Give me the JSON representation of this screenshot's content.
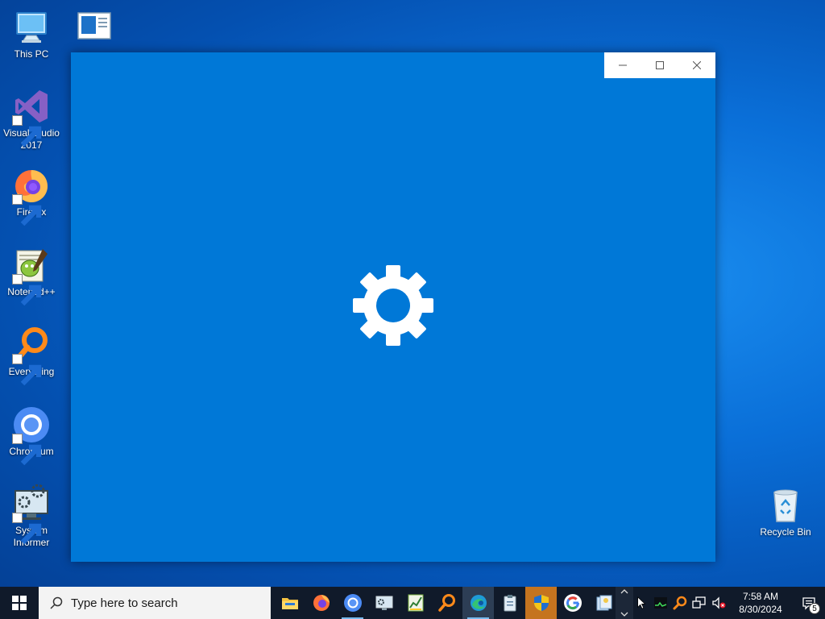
{
  "desktop": {
    "icons": [
      {
        "label": "This PC",
        "icon": "this-pc-icon"
      },
      {
        "label": "",
        "icon": "document-icon"
      },
      {
        "label": "Visual Studio 2017",
        "icon": "visual-studio-icon"
      },
      {
        "label": "Firefox",
        "icon": "firefox-icon"
      },
      {
        "label": "Notepad++",
        "icon": "notepad-plus-plus-icon"
      },
      {
        "label": "Everything",
        "icon": "everything-search-icon"
      },
      {
        "label": "Chromium",
        "icon": "chromium-icon"
      },
      {
        "label": "System Informer",
        "icon": "system-informer-icon"
      },
      {
        "label": "Recycle Bin",
        "icon": "recycle-bin-icon"
      }
    ]
  },
  "window": {
    "background": "#0078d7",
    "splash_icon": "gear-icon",
    "controls": [
      "minimize-icon",
      "maximize-icon",
      "close-icon"
    ]
  },
  "taskbar": {
    "search_placeholder": "Type here to search",
    "pinned": [
      {
        "icon": "file-explorer-icon"
      },
      {
        "icon": "firefox-icon"
      },
      {
        "icon": "chromium-icon"
      },
      {
        "icon": "system-informer-icon"
      },
      {
        "icon": "task-chart-icon"
      },
      {
        "icon": "everything-search-icon"
      },
      {
        "icon": "edge-icon"
      },
      {
        "icon": "clipboard-icon"
      },
      {
        "icon": "uac-shield-icon"
      },
      {
        "icon": "google-icon"
      },
      {
        "icon": "sticky-notes-icon"
      }
    ],
    "clock": {
      "time": "7:58 AM",
      "date": "8/30/2024"
    },
    "notification_count": "5"
  },
  "colors": {
    "accent": "#0078d7",
    "taskbar": "#101a2a",
    "search_box": "#f3f3f3"
  }
}
